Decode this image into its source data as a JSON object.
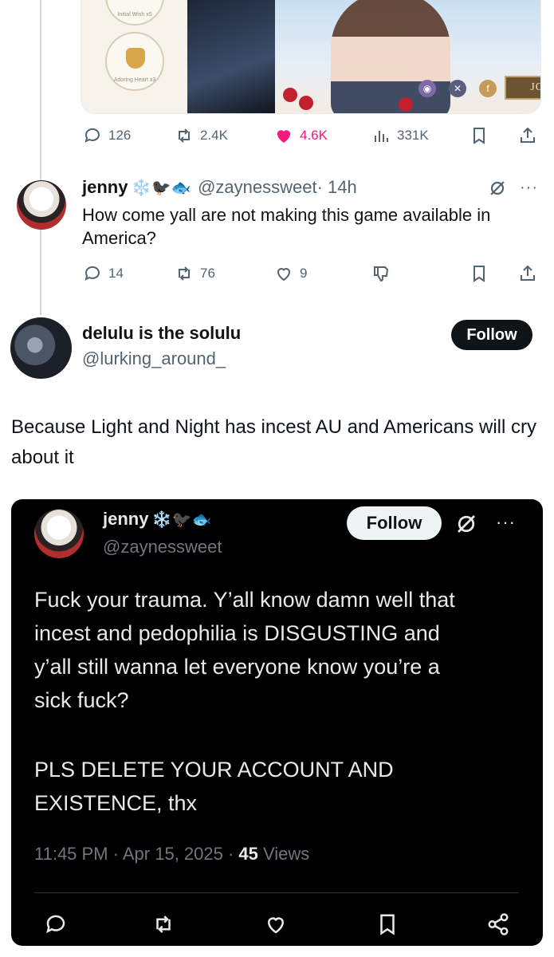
{
  "promo": {
    "badge1_label": "Initial Wish x5",
    "badge2_label": "Adoring Heart x3",
    "join_label": "JOIN NOW"
  },
  "original_tweet": {
    "replies": "126",
    "reposts": "2.4K",
    "likes": "4.6K",
    "views": "331K"
  },
  "reply": {
    "name": "jenny",
    "emojis": "❄️🐦‍⬛🐟",
    "handle": "@zaynessweet",
    "time": "· 14h",
    "text": "How come yall are not making this game available in America?",
    "replies": "14",
    "reposts": "76",
    "likes": "9"
  },
  "post": {
    "name": "delulu is the solulu",
    "handle": "@lurking_around_",
    "follow_label": "Follow",
    "text": "Because Light and Night has incest AU and Americans will cry about it"
  },
  "quoted": {
    "name": "jenny",
    "emojis": "❄️🐦‍⬛🐟",
    "handle": "@zaynessweet",
    "follow_label": "Follow",
    "text_line1": "Fuck your trauma. Y’all know damn well that",
    "text_line2": "incest and pedophilia is DISGUSTING and",
    "text_line3": "y’all still wanna let everyone know you’re a",
    "text_line4": "sick fuck?",
    "text_line5": "PLS DELETE YOUR ACCOUNT AND",
    "text_line6": "EXISTENCE, thx",
    "timestamp": "11:45 PM · Apr 15, 2025 · ",
    "views_count": "45",
    "views_label": " Views"
  },
  "colors": {
    "like_pink": "#f91880",
    "secondary_gray": "#536471",
    "dark_bg": "#000000"
  }
}
